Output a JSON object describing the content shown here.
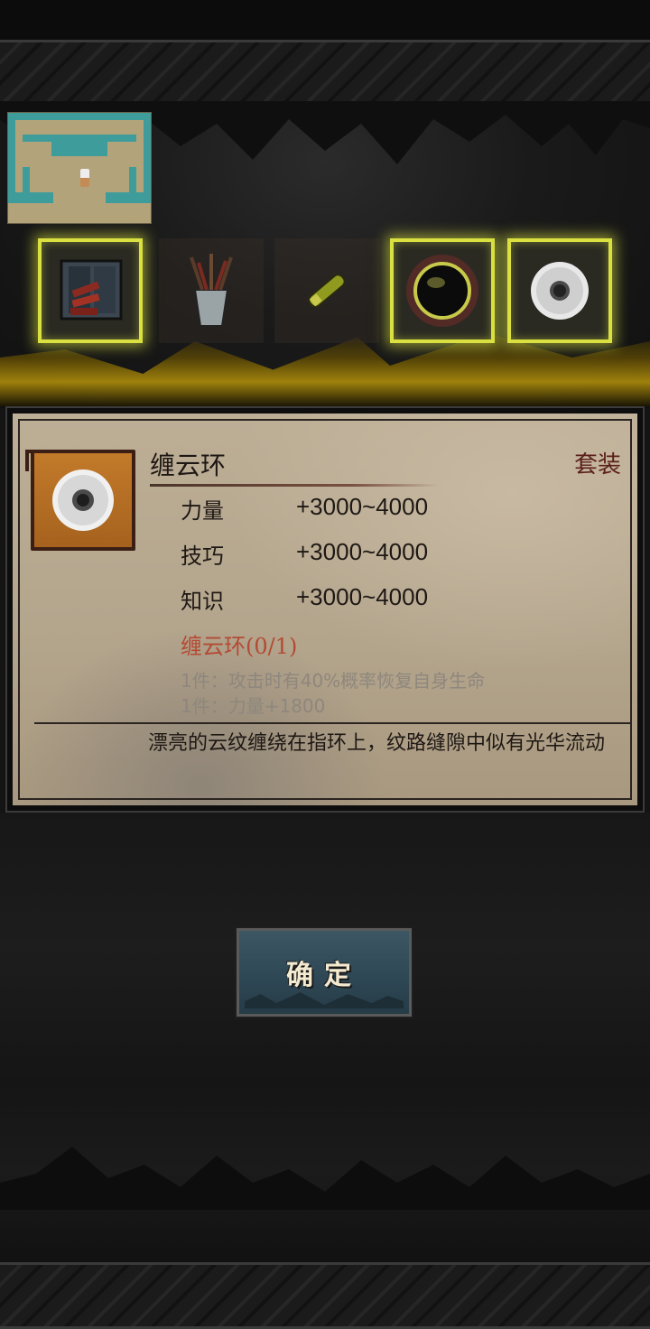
{
  "inventory": {
    "slots": [
      {
        "icon": "chest-of-dynamite-icon",
        "highlighted": true
      },
      {
        "icon": "cup-of-arrows-icon",
        "highlighted": false
      },
      {
        "icon": "scroll-icon",
        "highlighted": false
      },
      {
        "icon": "dark-orb-icon",
        "highlighted": true
      },
      {
        "icon": "cloud-ring-icon",
        "highlighted": true
      }
    ]
  },
  "item": {
    "name": "缠云环",
    "type": "套装",
    "icon": "cloud-ring-icon",
    "stats": [
      {
        "label": "力量",
        "value": "+3000~4000"
      },
      {
        "label": "技巧",
        "value": "+3000~4000"
      },
      {
        "label": "知识",
        "value": "+3000~4000"
      }
    ],
    "set_name": "缠云环(0/1)",
    "set_bonuses": [
      "1件：攻击时有40%概率恢复自身生命",
      "1件：力量+1800"
    ],
    "description": "漂亮的云纹缠绕在指环上，纹路缝隙中似有光华流动"
  },
  "confirm_button": {
    "label": "确定"
  },
  "colors": {
    "highlight": "#d9e040",
    "set_name": "#b44a33",
    "panel": "#b3a48c"
  }
}
